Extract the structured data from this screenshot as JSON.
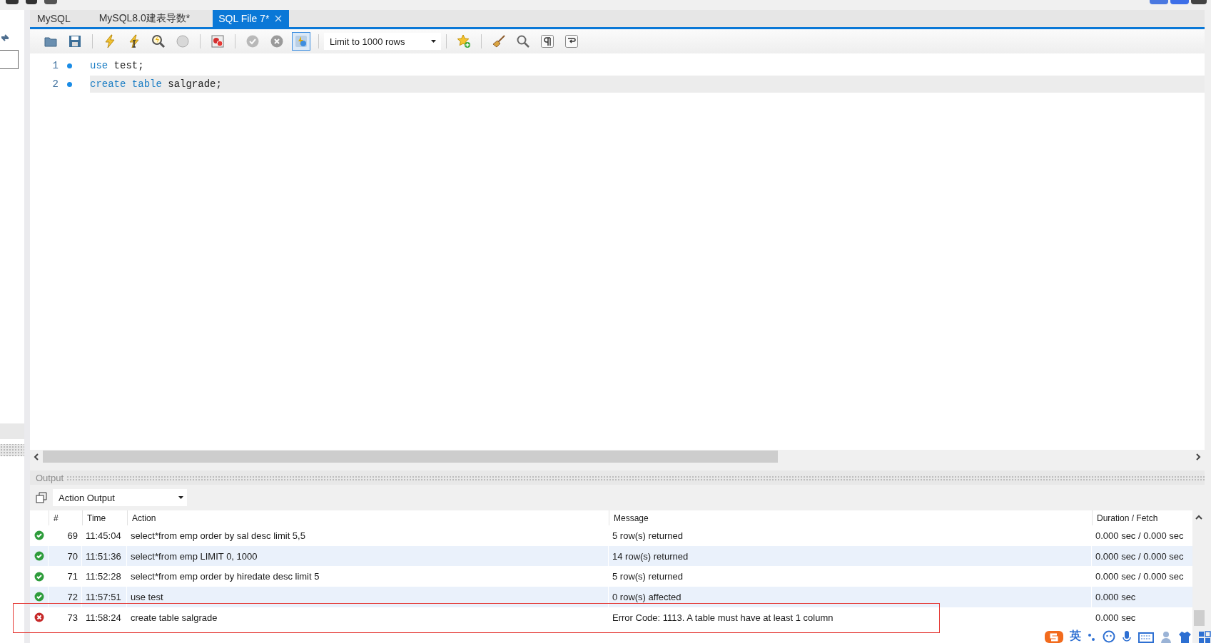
{
  "tabs": [
    {
      "label": "MySQL",
      "selected": false,
      "closable": false
    },
    {
      "label": "MySQL8.0建表导数*",
      "selected": false,
      "closable": false
    },
    {
      "label": "SQL File 7*",
      "selected": true,
      "closable": true
    }
  ],
  "toolbar_groups": [
    [
      {
        "kind": "open",
        "disabled": false,
        "pressed": false
      },
      {
        "kind": "save",
        "disabled": false,
        "pressed": false
      }
    ],
    [
      {
        "kind": "execute",
        "disabled": false,
        "pressed": false
      },
      {
        "kind": "execute-current",
        "disabled": false,
        "pressed": false
      },
      {
        "kind": "explain",
        "disabled": false,
        "pressed": false
      },
      {
        "kind": "stop",
        "disabled": false,
        "pressed": false
      }
    ],
    [
      {
        "kind": "stop-on-error",
        "disabled": false,
        "pressed": false
      }
    ],
    [
      {
        "kind": "commit",
        "disabled": true,
        "pressed": false
      },
      {
        "kind": "rollback",
        "disabled": true,
        "pressed": false
      },
      {
        "kind": "autocommit",
        "disabled": false,
        "pressed": true
      }
    ],
    [
      {
        "kind": "select",
        "value": "Limit to 1000 rows"
      }
    ],
    [
      {
        "kind": "snippet",
        "disabled": false,
        "pressed": false
      }
    ],
    [
      {
        "kind": "beautify",
        "disabled": false,
        "pressed": false
      },
      {
        "kind": "find",
        "disabled": false,
        "pressed": false
      },
      {
        "kind": "invisibles",
        "disabled": false,
        "pressed": false
      },
      {
        "kind": "wrap",
        "disabled": false,
        "pressed": false
      }
    ]
  ],
  "editor": {
    "lines": [
      {
        "number": "1",
        "current": false,
        "tokens": [
          {
            "text": "use",
            "kind": "keyword"
          },
          {
            "text": " test;",
            "kind": "plain"
          }
        ]
      },
      {
        "number": "2",
        "current": true,
        "tokens": [
          {
            "text": "create",
            "kind": "keyword"
          },
          {
            "text": " table",
            "kind": "keyword"
          },
          {
            "text": " salgrade;",
            "kind": "plain"
          }
        ]
      }
    ]
  },
  "output": {
    "title": "Output",
    "view": "Action Output",
    "columns": [
      "#",
      "Time",
      "Action",
      "Message",
      "Duration / Fetch"
    ],
    "rows": [
      {
        "kind": "ok",
        "number": "69",
        "time": "11:45:04",
        "action": "select*from emp order by sal desc limit 5,5",
        "message": "5 row(s) returned",
        "duration": "0.000 sec / 0.000 sec"
      },
      {
        "kind": "ok",
        "number": "70",
        "time": "11:51:36",
        "action": "select*from emp LIMIT 0, 1000",
        "message": "14 row(s) returned",
        "duration": "0.000 sec / 0.000 sec"
      },
      {
        "kind": "ok",
        "number": "71",
        "time": "11:52:28",
        "action": "select*from emp order by hiredate desc limit 5",
        "message": "5 row(s) returned",
        "duration": "0.000 sec / 0.000 sec"
      },
      {
        "kind": "ok",
        "number": "72",
        "time": "11:57:51",
        "action": "use test",
        "message": "0 row(s) affected",
        "duration": "0.000 sec"
      },
      {
        "kind": "error",
        "number": "73",
        "time": "11:58:24",
        "action": "create table salgrade",
        "message": "Error Code: 1113. A table must have at least 1 column",
        "duration": "0.000 sec"
      }
    ]
  },
  "ime": {
    "language": "英"
  }
}
